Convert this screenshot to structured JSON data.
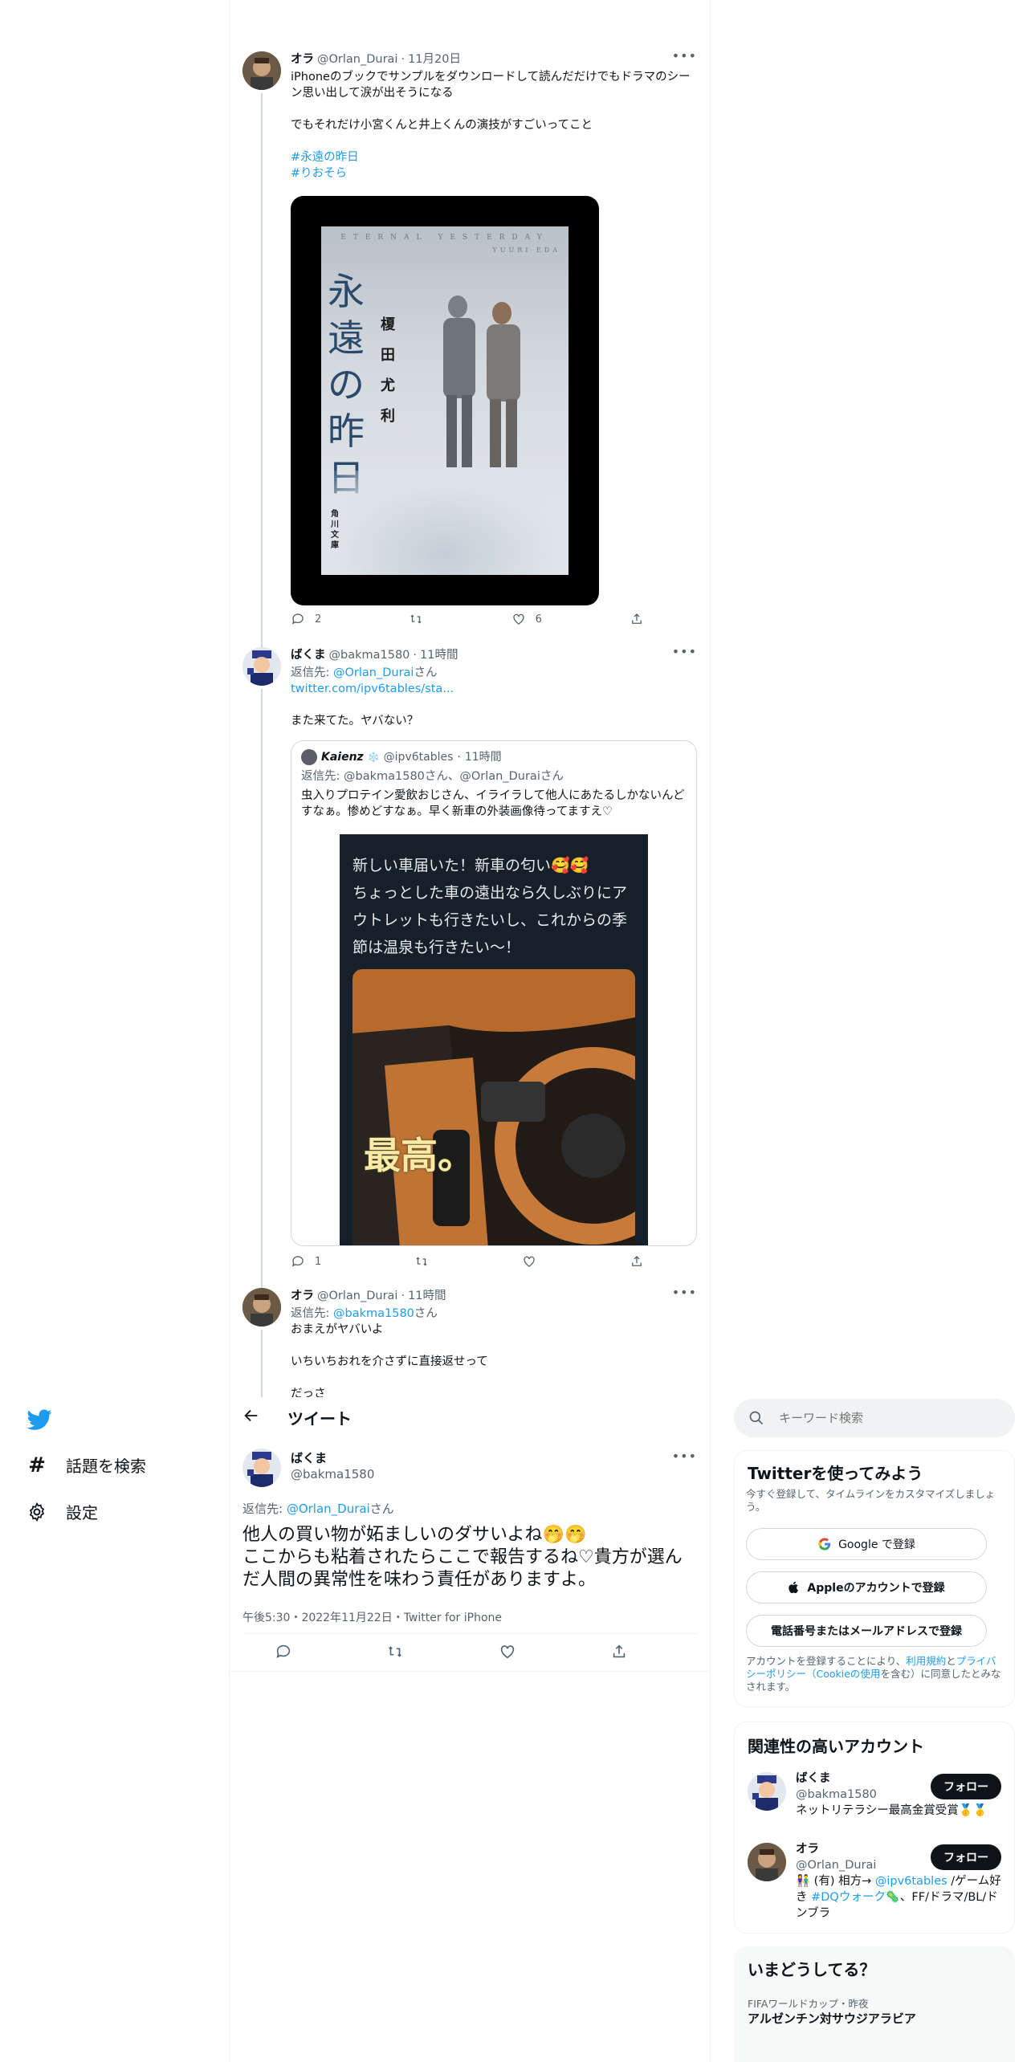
{
  "nav": {
    "explore_label": "話題を検索",
    "settings_label": "設定"
  },
  "tweets": [
    {
      "name": "オラ",
      "handle": "@Orlan_Durai",
      "time": "11月20日",
      "text1": "iPhoneのブックでサンプルをダウンロードして読んだだけでもドラマのシーン思い出して涙が出そうになる",
      "text2": "でもそれだけ小宮くんと井上くんの演技がすごいってこと",
      "hashtag1": "#永遠の昨日",
      "hashtag2": "#りおそら",
      "book": {
        "header": "ETERNAL YESTERDAY",
        "author_en": "YUURI EDA",
        "title": "永遠の昨日",
        "author": "榎田尤利",
        "publisher": "角川文庫"
      },
      "replies": "2",
      "likes": "6"
    },
    {
      "name": "ばくま",
      "handle": "@bakma1580",
      "time": "11時間",
      "reply_prefix": "返信先: ",
      "reply_to": "@Orlan_Durai",
      "reply_suffix": "さん",
      "link": "twitter.com/ipv6tables/sta...",
      "text": "また来てた。ヤバない？",
      "quote": {
        "name": "Kaienz",
        "handle": "@ipv6tables",
        "time": "11時間",
        "reply": "返信先: @bakma1580さん、@Orlan_Duraiさん",
        "text": "虫入りプロテイン愛飲おじさん、イライラして他人にあたるしかないんどすなぁ。惨めどすなぁ。早く新車の外装画像待ってますえ♡",
        "image_text": "新しい車届いた！新車の匂い🥰🥰\nちょっとした車の遠出なら久しぶりにアウトレットも行きたいし、これからの季節は温泉も行きたい〜！",
        "stamp": "最高。"
      },
      "replies": "1"
    },
    {
      "name": "オラ",
      "handle": "@Orlan_Durai",
      "time": "11時間",
      "reply_prefix": "返信先: ",
      "reply_to": "@bakma1580",
      "reply_suffix": "さん",
      "text1": "おまえがヤバいよ",
      "text2": "いちいちおれを介さずに直接返せって",
      "text3": "だっさ"
    }
  ],
  "focus": {
    "header_title": "ツイート",
    "name": "ばくま",
    "handle": "@bakma1580",
    "reply_prefix": "返信先: ",
    "reply_to": "@Orlan_Durai",
    "reply_suffix": "さん",
    "text": "他人の買い物が妬ましいのダサいよね🤭🤭\nここからも粘着されたらここで報告するね♡貴方が選んだ人間の異常性を味わう責任がありますよ。",
    "meta": "午後5:30・2022年11月22日・Twitter for iPhone"
  },
  "sidebar": {
    "search_placeholder": "キーワード検索",
    "signup": {
      "title": "Twitterを使ってみよう",
      "subtitle": "今すぐ登録して、タイムラインをカスタマイズしましょう。",
      "google": "Google で登録",
      "apple": "Appleのアカウントで登録",
      "phone": "電話番号またはメールアドレスで登録",
      "terms_prefix": "アカウントを登録することにより、",
      "terms_link1": "利用規約",
      "terms_mid": "と",
      "terms_link2": "プライバシーポリシー（Cookieの使用",
      "terms_suffix": "を含む）に同意したとみなされます。"
    },
    "related": {
      "title": "関連性の高いアカウント",
      "follow": "フォロー",
      "accounts": [
        {
          "name": "ばくま",
          "handle": "@bakma1580",
          "bio": "ネットリテラシー最高金賞受賞🥇🥇"
        },
        {
          "name": "オラ",
          "handle": "@Orlan_Durai",
          "bio_pre": "👫 (有) 相方→ ",
          "bio_link1": "@ipv6tables",
          "bio_mid": " /ゲーム好き ",
          "bio_link2": "#DQウォーク",
          "bio_post": "🦠、FF/ドラマ/BL/ドンブラ"
        }
      ]
    },
    "trends": {
      "title": "いまどうしてる？",
      "context": "FIFAワールドカップ・昨夜",
      "topic": "アルゼンチン対サウジアラビア"
    }
  }
}
